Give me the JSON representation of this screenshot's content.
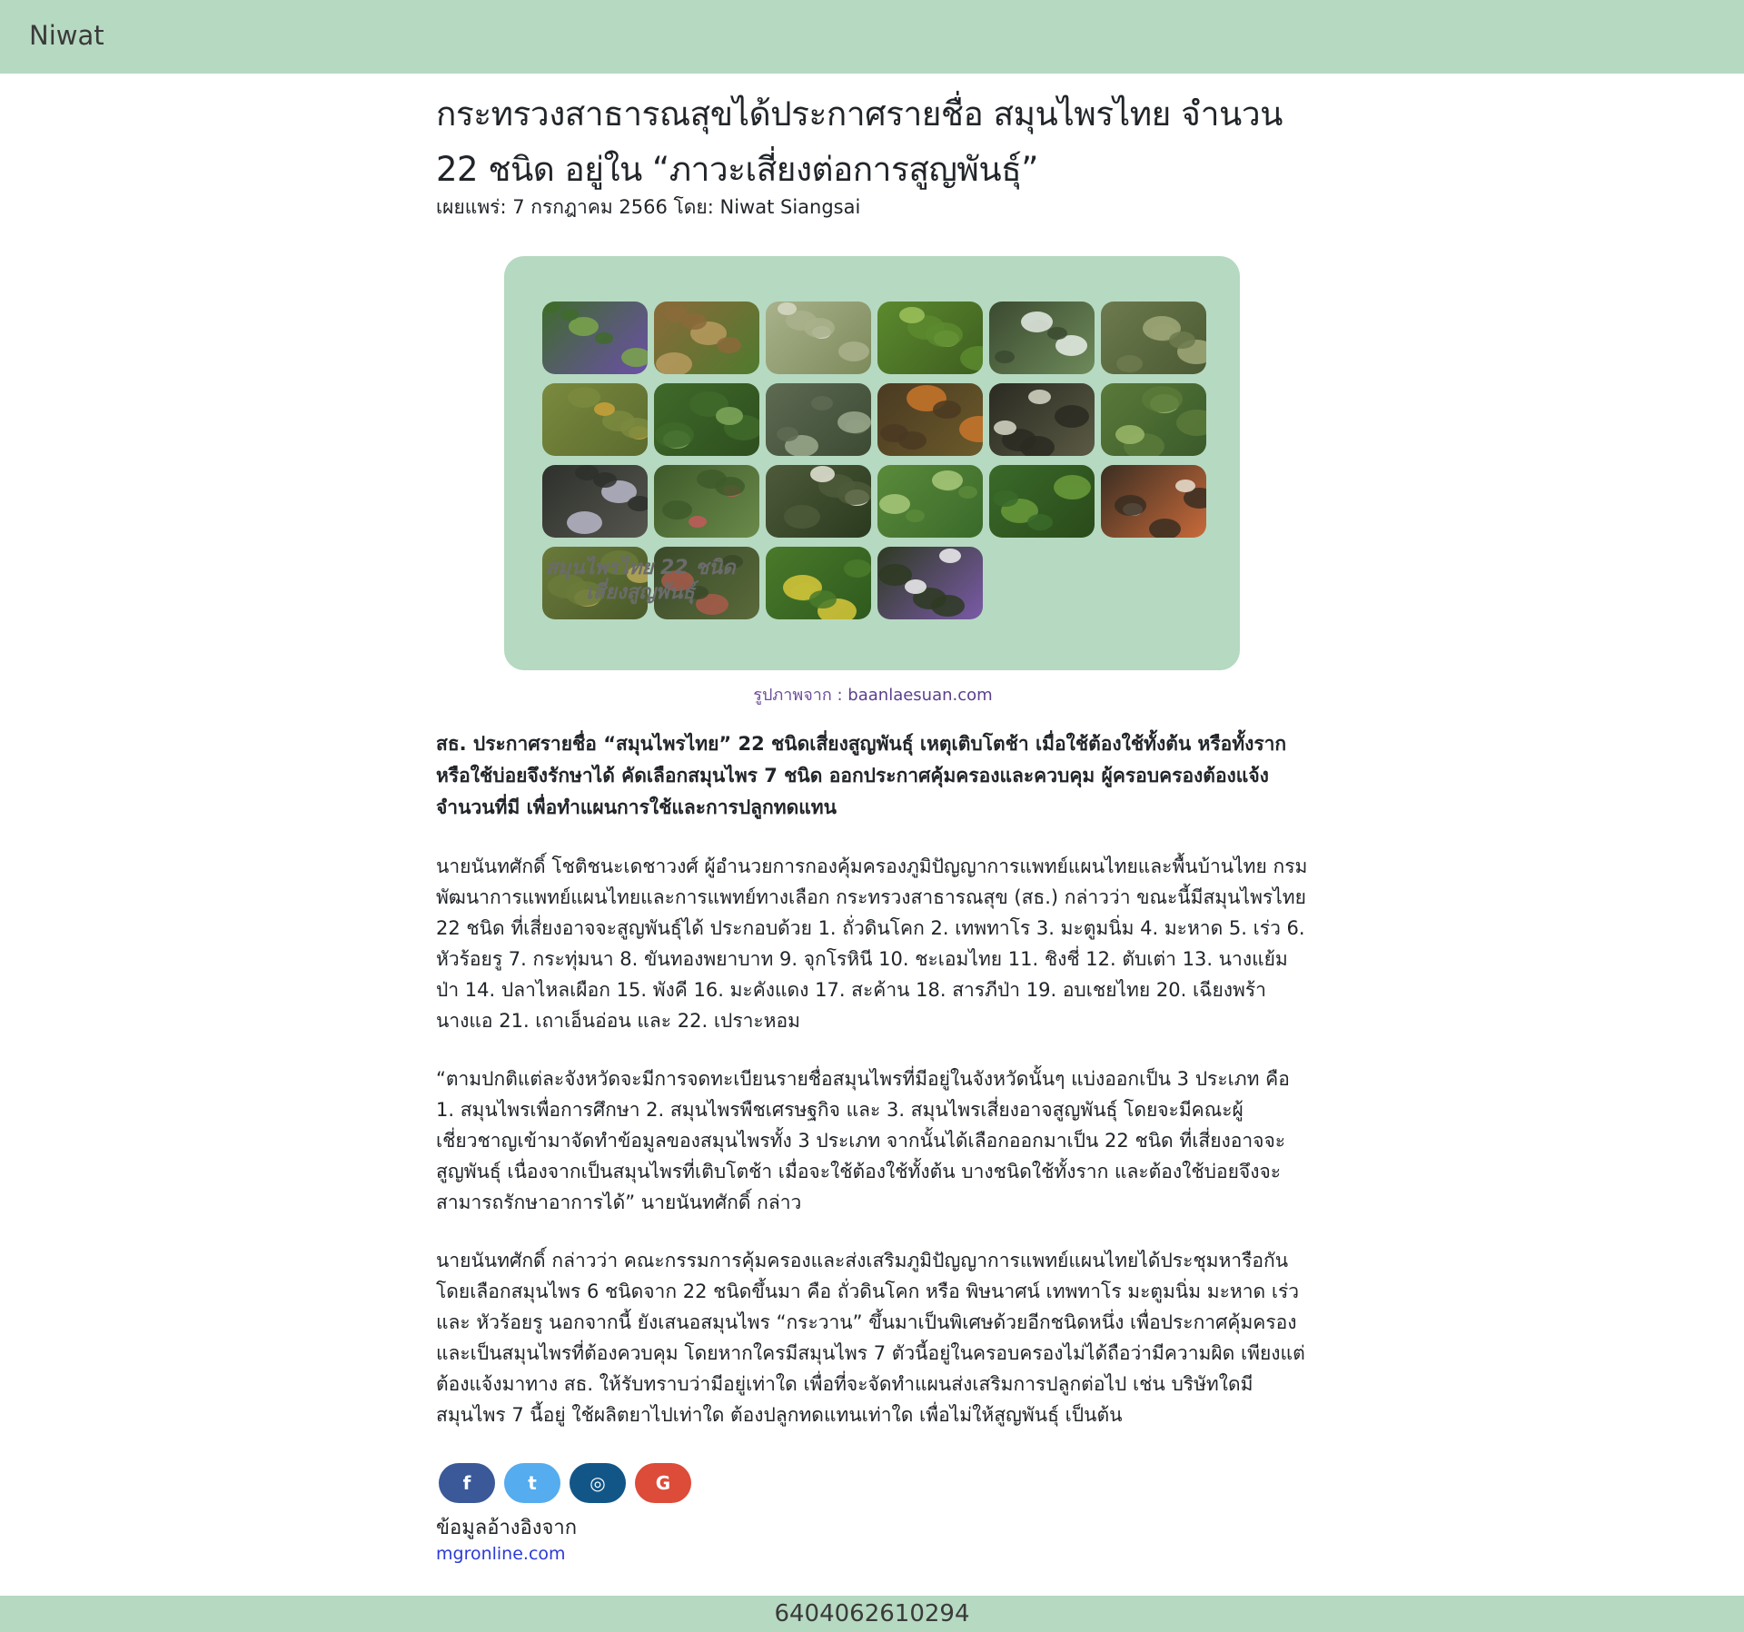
{
  "navbar": {
    "brand": "Niwat"
  },
  "article": {
    "title": "กระทรวงสาธารณสุขได้ประกาศรายชื่อ สมุนไพรไทย จำนวน 22 ชนิด อยู่ใน “ภาวะเสี่ยงต่อการสูญพันธุ์”",
    "meta": "เผยแพร่: 7 กรกฎาคม 2566 โดย: Niwat Siangsai",
    "figure_text_line1": "สมุนไพรไทย 22 ชนิด",
    "figure_text_line2": "เสี่ยงสูญพันธุ์",
    "caption_prefix": "รูปภาพจาก : ",
    "caption_source": "baanlaesuan.com",
    "lead": "สธ. ประกาศรายชื่อ “สมุนไพรไทย” 22 ชนิดเสี่ยงสูญพันธุ์ เหตุเติบโตช้า เมื่อใช้ต้องใช้ทั้งต้น หรือทั้งราก หรือใช้บ่อยจึงรักษาได้ คัดเลือกสมุนไพร 7 ชนิด ออกประกาศคุ้มครองและควบคุม ผู้ครอบครองต้องแจ้งจำนวนที่มี เพื่อทำแผนการใช้และการปลูกทดแทน",
    "paragraph1": "นายนันทศักดิ์ โชติชนะเดชาวงศ์ ผู้อำนวยการกองคุ้มครองภูมิปัญญาการแพทย์แผนไทยและพื้นบ้านไทย กรมพัฒนาการแพทย์แผนไทยและการแพทย์ทางเลือก กระทรวงสาธารณสุข (สธ.) กล่าวว่า ขณะนี้มีสมุนไพรไทย 22 ชนิด ที่เสี่ยงอาจจะสูญพันธุ์ได้ ประกอบด้วย 1. ถั่วดินโคก 2. เทพทาโร 3. มะตูมนิ่ม 4. มะหาด 5. เร่ว 6. หัวร้อยรู 7. กระทุ่มนา 8. ขันทองพยาบาท 9. จุกโรหินี 10. ชะเอมไทย 11. ชิงชี่ 12. ตับเต่า 13. นางแย้มป่า 14. ปลาไหลเผือก 15. พังคี 16. มะคังแดง 17. สะค้าน 18. สารภีป่า 19. อบเชยไทย 20. เฉียงพร้านางแอ 21. เถาเอ็นอ่อน และ 22. เปราะหอม",
    "paragraph2": "“ตามปกติแต่ละจังหวัดจะมีการจดทะเบียนรายชื่อสมุนไพรที่มีอยู่ในจังหวัดนั้นๆ แบ่งออกเป็น 3 ประเภท คือ 1. สมุนไพรเพื่อการศึกษา 2. สมุนไพรพืชเศรษฐกิจ และ 3. สมุนไพรเสี่ยงอาจสูญพันธุ์ โดยจะมีคณะผู้เชี่ยวชาญเข้ามาจัดทำข้อมูลของสมุนไพรทั้ง 3 ประเภท จากนั้นได้เลือกออกมาเป็น 22 ชนิด ที่เสี่ยงอาจจะสูญพันธุ์ เนื่องจากเป็นสมุนไพรที่เติบโตช้า เมื่อจะใช้ต้องใช้ทั้งต้น บางชนิดใช้ทั้งราก และต้องใช้บ่อยจึงจะสามารถรักษาอาการได้” นายนันทศักดิ์ กล่าว",
    "paragraph3": "นายนันทศักดิ์ กล่าวว่า คณะกรรมการคุ้มครองและส่งเสริมภูมิปัญญาการแพทย์แผนไทยได้ประชุมหารือกัน โดยเลือกสมุนไพร 6 ชนิดจาก 22 ชนิดขึ้นมา คือ ถั่วดินโคก หรือ พิษนาศน์ เทพทาโร มะตูมนิ่ม มะหาด เร่ว และ หัวร้อยรู นอกจากนี้ ยังเสนอสมุนไพร “กระวาน” ขึ้นมาเป็นพิเศษด้วยอีกชนิดหนึ่ง เพื่อประกาศคุ้มครองและเป็นสมุนไพรที่ต้องควบคุม โดยหากใครมีสมุนไพร 7 ตัวนี้อยู่ในครอบครองไม่ได้ถือว่ามีความผิด เพียงแต่ต้องแจ้งมาทาง สธ. ให้รับทราบว่ามีอยู่เท่าใด เพื่อที่จะจัดทำแผนส่งเสริมการปลูกต่อไป เช่น บริษัทใดมีสมุนไพร 7 นี้อยู่ ใช้ผลิตยาไปเท่าใด ต้องปลูกทดแทนเท่าใด เพื่อไม่ให้สูญพันธุ์ เป็นต้น",
    "reference_label": "ข้อมูลอ้างอิงจาก",
    "reference_link": "mgronline.com"
  },
  "social": [
    {
      "icon": "facebook-icon",
      "glyph": "f",
      "color": "#3b5998"
    },
    {
      "icon": "twitter-icon",
      "glyph": "t",
      "color": "#55acee"
    },
    {
      "icon": "instagram-icon",
      "glyph": "◎",
      "color": "#125688"
    },
    {
      "icon": "google-icon",
      "glyph": "G",
      "color": "#dd4b39"
    }
  ],
  "footer": {
    "text": "6404062610294"
  },
  "colors": {
    "accent": "#b6d9c1"
  }
}
